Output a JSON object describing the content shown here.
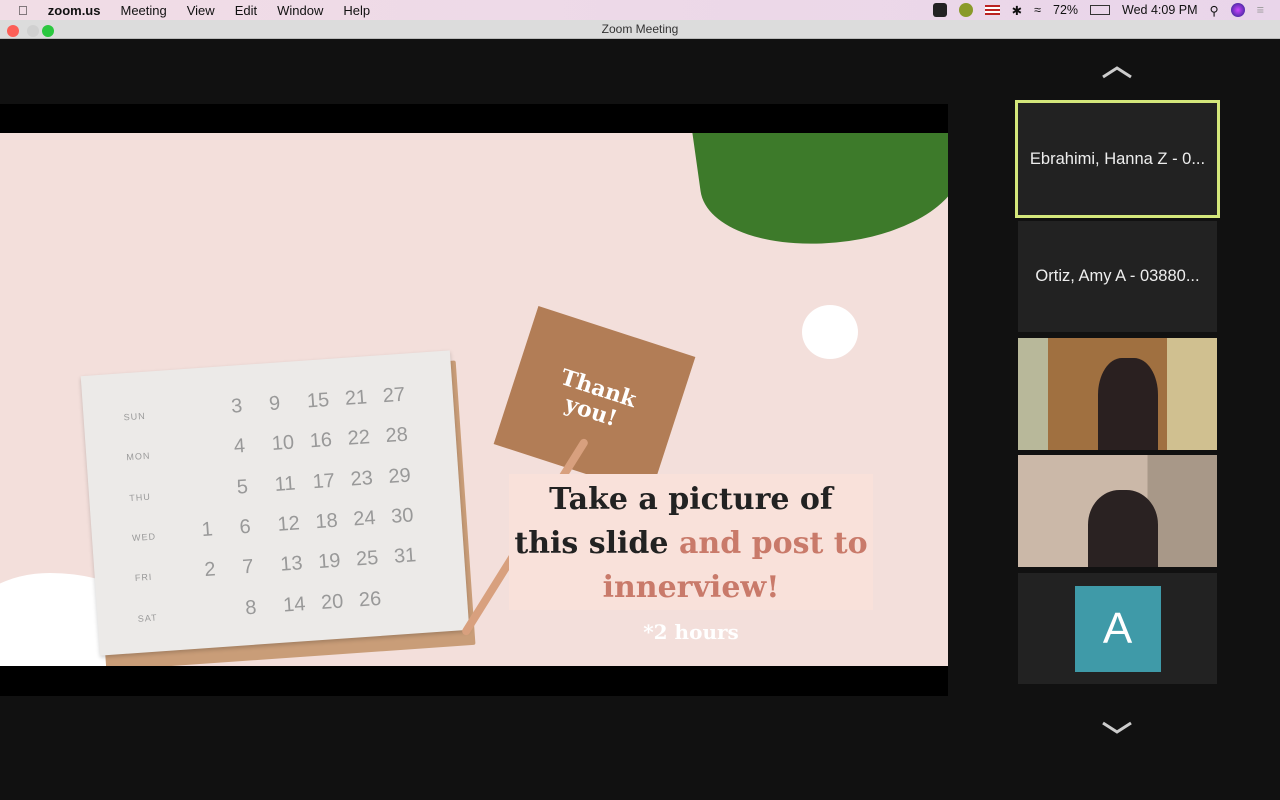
{
  "menubar": {
    "app": "zoom.us",
    "items": [
      "Meeting",
      "View",
      "Edit",
      "Window",
      "Help"
    ],
    "battery": "72%",
    "clock": "Wed 4:09 PM"
  },
  "window": {
    "title": "Zoom Meeting"
  },
  "slide": {
    "note": "Thank you!",
    "line1": "Take a picture of",
    "line2a": "this slide ",
    "line2b": "and post to",
    "line3": "innerview!",
    "footnote": "*2 hours",
    "calendar": {
      "days": [
        "SUN",
        "MON",
        "THU",
        "WED",
        "FRI",
        "SAT"
      ],
      "rows": [
        [
          "",
          "3",
          "9",
          "15",
          "21",
          "27"
        ],
        [
          "",
          "4",
          "10",
          "16",
          "22",
          "28"
        ],
        [
          "",
          "5",
          "11",
          "17",
          "23",
          "29"
        ],
        [
          "1",
          "6",
          "12",
          "18",
          "24",
          "30"
        ],
        [
          "2",
          "7",
          "13",
          "19",
          "25",
          "31"
        ],
        [
          "",
          "8",
          "14",
          "20",
          "26",
          ""
        ]
      ]
    }
  },
  "participants": [
    {
      "name": "Ebrahimi, Hanna Z - 0...",
      "active": true
    },
    {
      "name": "Ortiz, Amy A - 03880..."
    },
    {
      "name": "",
      "video": true
    },
    {
      "name": "",
      "video": true
    },
    {
      "name": "",
      "avatar": "A"
    }
  ],
  "colors": {
    "active_border": "#d4e77b",
    "avatar": "#3f9aa8",
    "accent_text": "#c97a6a"
  }
}
